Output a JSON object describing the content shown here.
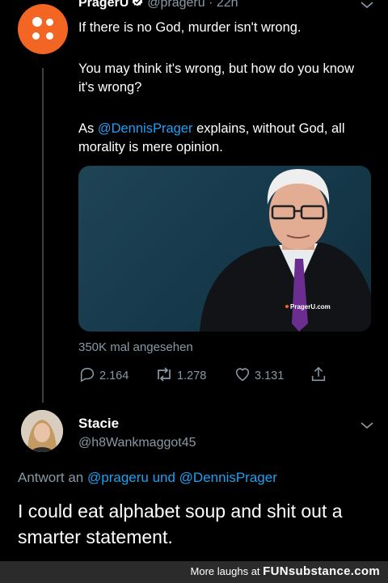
{
  "tweet": {
    "author_name": "PragerU",
    "author_handle": "@prageru",
    "timestamp": "22h",
    "separator": "·",
    "line1": "If there is no God, murder isn't wrong.",
    "line2": "You may think it's wrong, but how do you know it's wrong?",
    "line3_prefix": "As ",
    "line3_mention": "@DennisPrager",
    "line3_suffix": " explains, without God, all morality is mere opinion.",
    "video_watermark": "PragerU.com",
    "views": "350K mal angesehen",
    "actions": {
      "replies": "2.164",
      "retweets": "1.278",
      "likes": "3.131"
    },
    "icons": [
      "verified-badge-icon",
      "chevron-down-icon",
      "reply-icon",
      "retweet-icon",
      "like-icon",
      "share-icon"
    ],
    "colors": {
      "mention": "#1da1f2",
      "muted": "#8899a6",
      "brand": "#f26522"
    }
  },
  "reply": {
    "author_name": "Stacie",
    "author_handle": "@h8Wankmaggot45",
    "reply_to_prefix": "Antwort an ",
    "reply_to_mention1": "@prageru",
    "reply_to_and": " und ",
    "reply_to_mention2": "@DennisPrager",
    "text": "I could eat alphabet soup and shit out a smarter statement."
  },
  "footer": {
    "text": "More laughs at ",
    "brand": "FUNsubstance.com"
  }
}
